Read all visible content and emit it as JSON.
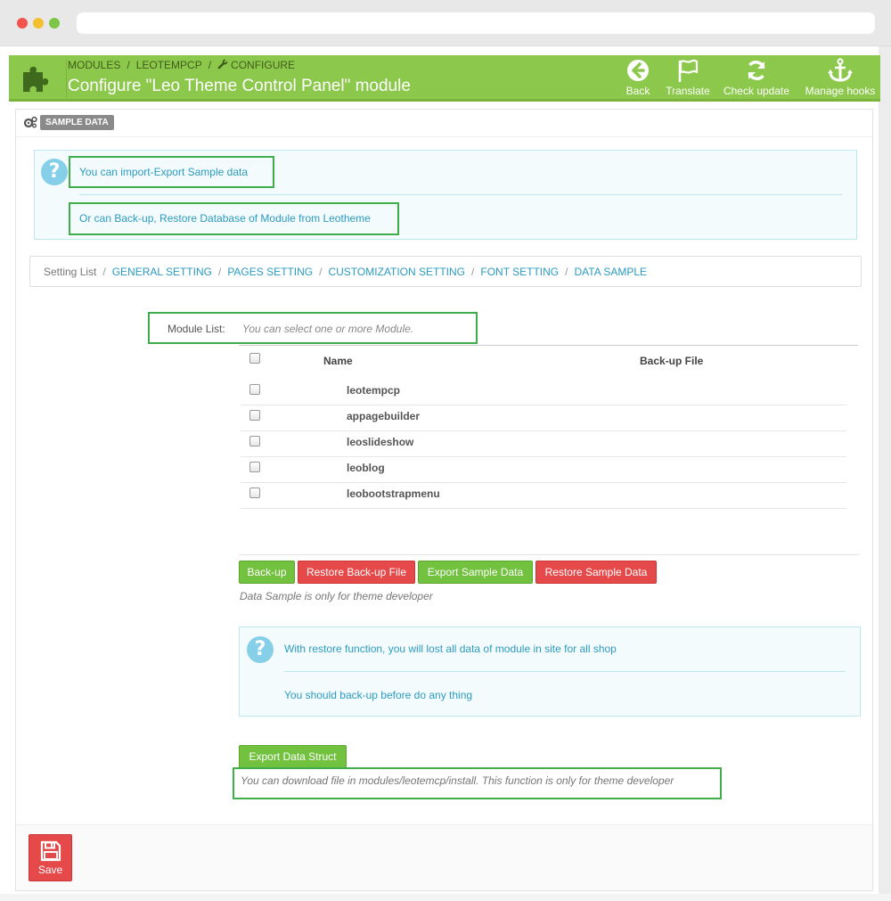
{
  "header": {
    "breadcrumb": [
      "MODULES",
      "LEOTEMPCP",
      "CONFIGURE"
    ],
    "title": "Configure \"Leo Theme Control Panel\" module",
    "toolbar": {
      "back": "Back",
      "translate": "Translate",
      "check_update": "Check update",
      "manage_hooks": "Manage hooks"
    }
  },
  "panel": {
    "heading_badge": "SAMPLE DATA",
    "info_top": [
      "You can import-Export Sample data",
      "Or can Back-up, Restore Database of Module from Leotheme"
    ],
    "setting_list": {
      "label": "Setting List",
      "separator": "/",
      "links": [
        "GENERAL SETTING",
        "PAGES SETTING",
        "CUSTOMIZATION SETTING",
        "FONT SETTING",
        "DATA SAMPLE"
      ]
    },
    "module_list": {
      "label": "Module List:",
      "hint": "You can select one or more Module."
    },
    "table": {
      "headers": {
        "name": "Name",
        "backup": "Back-up File"
      },
      "rows": [
        "leotempcp",
        "appagebuilder",
        "leoslideshow",
        "leoblog",
        "leobootstrapmenu"
      ]
    },
    "buttons": {
      "backup": "Back-up",
      "restore_backup": "Restore Back-up File",
      "export_sample": "Export Sample Data",
      "restore_sample": "Restore Sample Data"
    },
    "developer_note": "Data Sample is only for theme developer",
    "info_bottom": [
      "With restore function, you will lost all data of module in site for all shop",
      "You should back-up before do any thing"
    ],
    "export_struct": {
      "button": "Export Data Struct",
      "note": "You can download file in modules/leotemcp/install. This function is only for theme developer"
    },
    "save": "Save"
  },
  "colors": {
    "header_green": "#8cc84b",
    "link_blue": "#2b9bc0",
    "button_green": "#72c13f",
    "button_red": "#e5494a",
    "highlight_green": "#3fae4a"
  },
  "icons": [
    "puzzle-icon",
    "back-arrow-icon",
    "flag-icon",
    "refresh-icon",
    "anchor-icon",
    "gears-icon",
    "question-icon",
    "save-disk-icon",
    "wrench-icon"
  ]
}
